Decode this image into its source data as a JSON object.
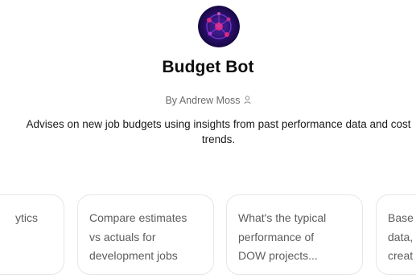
{
  "bot": {
    "name": "Budget Bot",
    "author": "By Andrew Moss",
    "description": "Advises on new job budgets using insights from past performance data and cost trends."
  },
  "starters": [
    {
      "text": "ytics"
    },
    {
      "text": "Compare estimates\nvs actuals for\ndevelopment jobs"
    },
    {
      "text": "What's the typical\nperformance of\nDOW projects..."
    },
    {
      "text": "Base\ndata,\ncreat"
    }
  ],
  "icons": {
    "avatar": "budget-bot-avatar-icon",
    "author": "person-icon"
  },
  "colors": {
    "avatar_bg": "#2a0f6b",
    "avatar_accent": "#e0247a",
    "card_border": "#e6e6e6",
    "muted_text": "#6b6b6b"
  }
}
